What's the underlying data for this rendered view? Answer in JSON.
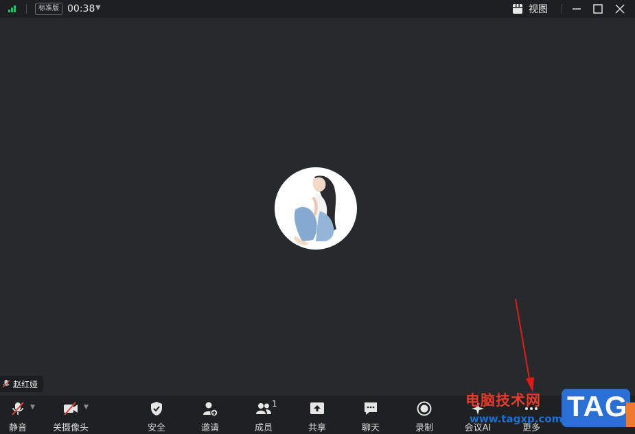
{
  "titlebar": {
    "edition_badge": "标准版",
    "timer": "00:38",
    "view_label": "视图"
  },
  "participant": {
    "name": "赵红娅",
    "mic_muted": true
  },
  "toolbar": {
    "mute_label": "静音",
    "camera_label": "关摄像头",
    "security_label": "安全",
    "invite_label": "邀请",
    "members_label": "成员",
    "members_count": "1",
    "share_label": "共享",
    "chat_label": "聊天",
    "record_label": "录制",
    "ai_label": "会议AI",
    "more_label": "更多"
  },
  "watermark": {
    "site_name": "电脑技术网",
    "url": "www.tagxp.com",
    "logo_text": "TAG"
  },
  "colors": {
    "background": "#272a2c",
    "titlebar": "#1d1f21",
    "toolbar": "#1e2022",
    "signal": "#23c06a",
    "muted_red": "#e0453a",
    "annotation_arrow": "#e01b1b"
  },
  "icons": {
    "signal": "signal-bars-icon",
    "view": "grid-view-icon",
    "minimize": "minimize-icon",
    "maximize": "maximize-icon",
    "close": "close-icon",
    "mic": "mic-off-icon",
    "camera": "camera-off-icon",
    "security": "shield-check-icon",
    "invite": "user-add-icon",
    "members": "users-icon",
    "share": "share-up-icon",
    "chat": "chat-bubble-icon",
    "record": "record-icon",
    "ai": "ai-icon",
    "more": "more-dots-icon"
  }
}
